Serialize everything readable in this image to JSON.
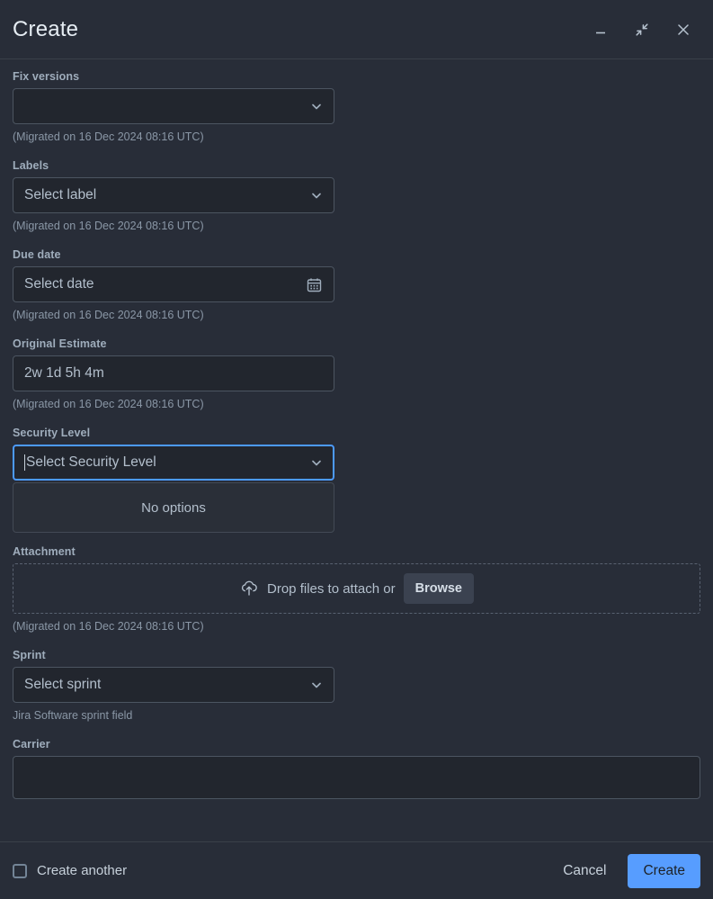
{
  "window": {
    "title": "Create",
    "controls": [
      {
        "name": "minimize-button",
        "icon": "minimize-icon"
      },
      {
        "name": "collapse-button",
        "icon": "collapse-icon"
      },
      {
        "name": "close-button",
        "icon": "close-icon"
      }
    ]
  },
  "fields": {
    "fix_versions": {
      "label": "Fix versions",
      "value": "",
      "help": "(Migrated on 16 Dec 2024 08:16 UTC)"
    },
    "labels": {
      "label": "Labels",
      "value": "Select label",
      "help": "(Migrated on 16 Dec 2024 08:16 UTC)"
    },
    "due_date": {
      "label": "Due date",
      "value": "Select date",
      "help": "(Migrated on 16 Dec 2024 08:16 UTC)"
    },
    "original_estimate": {
      "label": "Original Estimate",
      "value": "2w 1d 5h 4m",
      "help": "(Migrated on 16 Dec 2024 08:16 UTC)"
    },
    "security_level": {
      "label": "Security Level",
      "value": "Select Security Level",
      "menu_empty_text": "No options",
      "focused": true
    },
    "attachment": {
      "label": "Attachment",
      "drop_text": "Drop files to attach or",
      "browse_label": "Browse",
      "help": "(Migrated on 16 Dec 2024 08:16 UTC)"
    },
    "sprint": {
      "label": "Sprint",
      "value": "Select sprint",
      "help": "Jira Software sprint field"
    },
    "carrier": {
      "label": "Carrier",
      "value": ""
    }
  },
  "footer": {
    "create_another_label": "Create another",
    "create_another_checked": false,
    "cancel_label": "Cancel",
    "create_label": "Create"
  },
  "colors": {
    "background": "#282d38",
    "input_background": "#22262e",
    "accent": "#579dff",
    "focus_border": "#4c9aff",
    "label_text": "#9fadbc"
  }
}
